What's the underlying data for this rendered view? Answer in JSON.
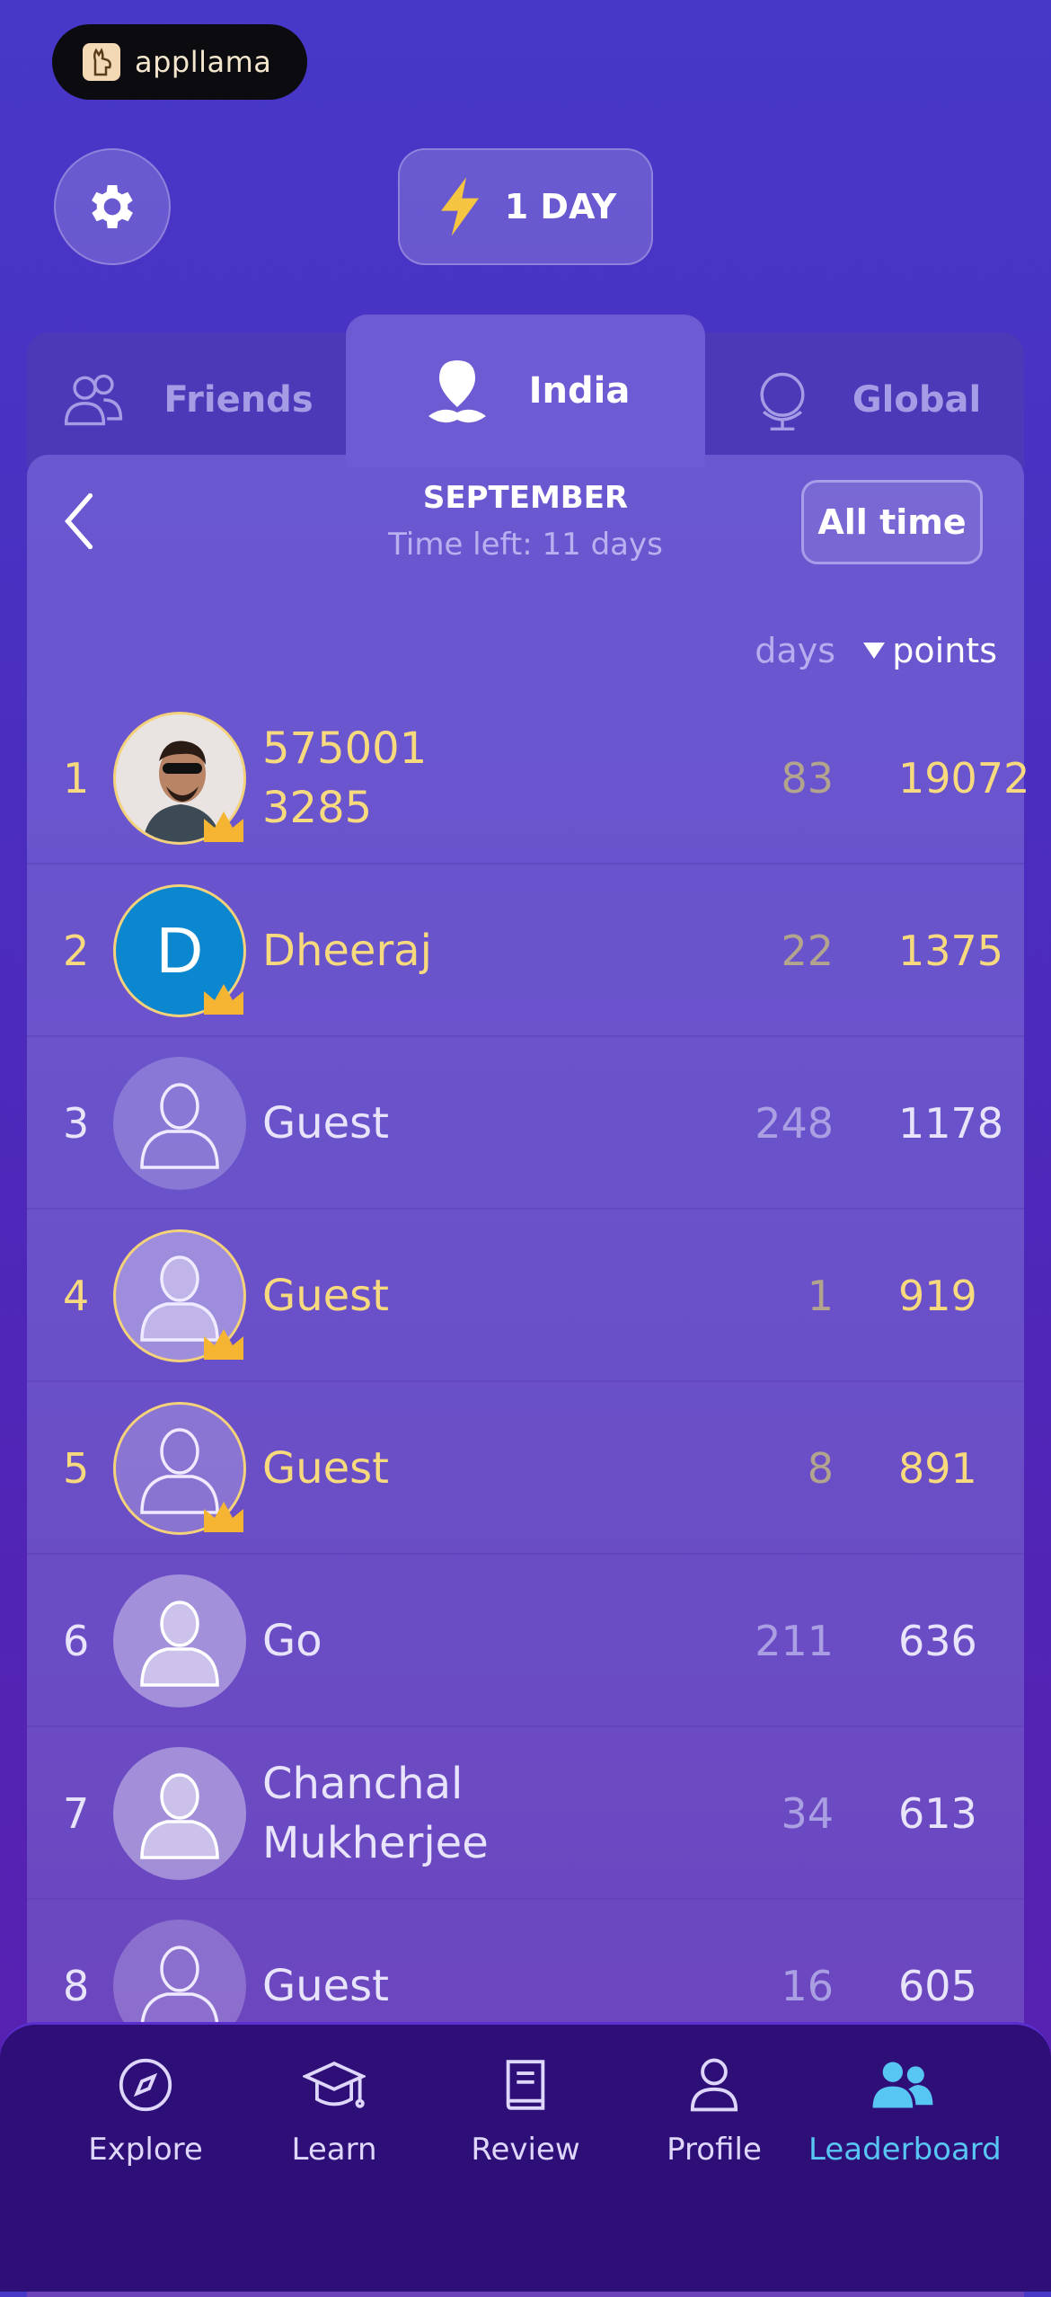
{
  "app": {
    "logo_text": "appllama"
  },
  "header": {
    "streak_label": "1 DAY"
  },
  "tabs": [
    {
      "label": "Friends",
      "active": false
    },
    {
      "label": "India",
      "active": true
    },
    {
      "label": "Global",
      "active": false
    }
  ],
  "period": {
    "month": "SEPTEMBER",
    "time_left": "Time left: 11 days",
    "all_time_label": "All time"
  },
  "columns": {
    "days": "days",
    "points": "points"
  },
  "leaderboard": [
    {
      "rank": "1",
      "name": "575001\n3285",
      "days": "83",
      "points": "19072"
    },
    {
      "rank": "2",
      "name": "Dheeraj",
      "days": "22",
      "points": "1375",
      "avatar_letter": "D"
    },
    {
      "rank": "3",
      "name": "Guest",
      "days": "248",
      "points": "1178"
    },
    {
      "rank": "4",
      "name": "Guest",
      "days": "1",
      "points": "919"
    },
    {
      "rank": "5",
      "name": "Guest",
      "days": "8",
      "points": "891"
    },
    {
      "rank": "6",
      "name": "Go",
      "days": "211",
      "points": "636"
    },
    {
      "rank": "7",
      "name": "Chanchal\nMukherjee",
      "days": "34",
      "points": "613"
    },
    {
      "rank": "8",
      "name": "Guest",
      "days": "16",
      "points": "605"
    }
  ],
  "nav": [
    {
      "label": "Explore",
      "icon": "compass-icon"
    },
    {
      "label": "Learn",
      "icon": "graduation-cap-icon"
    },
    {
      "label": "Review",
      "icon": "book-icon"
    },
    {
      "label": "Profile",
      "icon": "person-icon"
    },
    {
      "label": "Leaderboard",
      "icon": "group-icon",
      "active": true
    }
  ],
  "colors": {
    "highlight": "#f7da7e",
    "active_nav": "#58c6f3",
    "streak": "#f5c542"
  }
}
